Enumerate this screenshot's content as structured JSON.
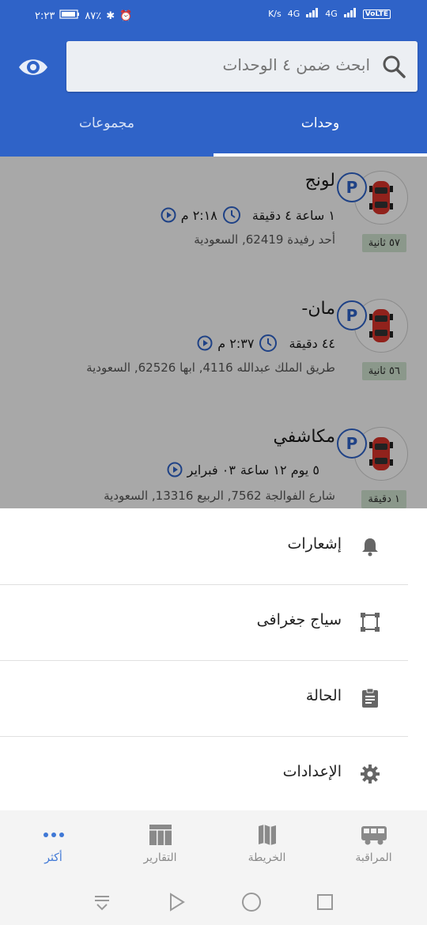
{
  "status_bar": {
    "time": "٢:٢٣",
    "battery": "٨٧٪",
    "speed_unit": "K/s",
    "network1": "4G",
    "network2": "4G",
    "volte": "VoLTE"
  },
  "search": {
    "placeholder": "ابحث ضمن ٤ الوحدات"
  },
  "tabs": [
    {
      "label": "وحدات",
      "active": true
    },
    {
      "label": "مجموعات",
      "active": false
    }
  ],
  "units": [
    {
      "name": "لونج",
      "time": "٢:١٨ م",
      "duration": "١ ساعة ٤ دقيقة",
      "address": "أحد رفيدة 62419, السعودية",
      "age": "٥٧ ثانية"
    },
    {
      "name": "مان-",
      "time": "٢:٣٧ م",
      "duration": "٤٤ دقيقة",
      "address": "طريق الملك عبدالله 4116, ابها 62526, السعودية",
      "age": "٥٦ ثانية"
    },
    {
      "name": "مكاشفي",
      "time": "٠٣ فبراير",
      "duration": "٥ يوم ١٢ ساعة",
      "address": "شارع الفوالجة 7562, الربيع 13316, السعودية",
      "age": "١ دقيقة"
    }
  ],
  "menu": [
    {
      "label": "إشعارات",
      "icon": "bell-icon"
    },
    {
      "label": "سياج جغرافى",
      "icon": "geofence-icon"
    },
    {
      "label": "الحالة",
      "icon": "clipboard-icon"
    },
    {
      "label": "الإعدادات",
      "icon": "gear-icon"
    }
  ],
  "bottom_nav": [
    {
      "label": "المراقبة",
      "icon": "bus-icon",
      "active": false
    },
    {
      "label": "الخريطة",
      "icon": "map-icon",
      "active": false
    },
    {
      "label": "التقارير",
      "icon": "table-icon",
      "active": false
    },
    {
      "label": "أكثر",
      "icon": "more-dots-icon",
      "active": true
    }
  ],
  "colors": {
    "primary": "#2f63c8",
    "active_nav": "#3f78d6",
    "age_badge": "#cfe3cf",
    "car_red": "#d9342b"
  }
}
